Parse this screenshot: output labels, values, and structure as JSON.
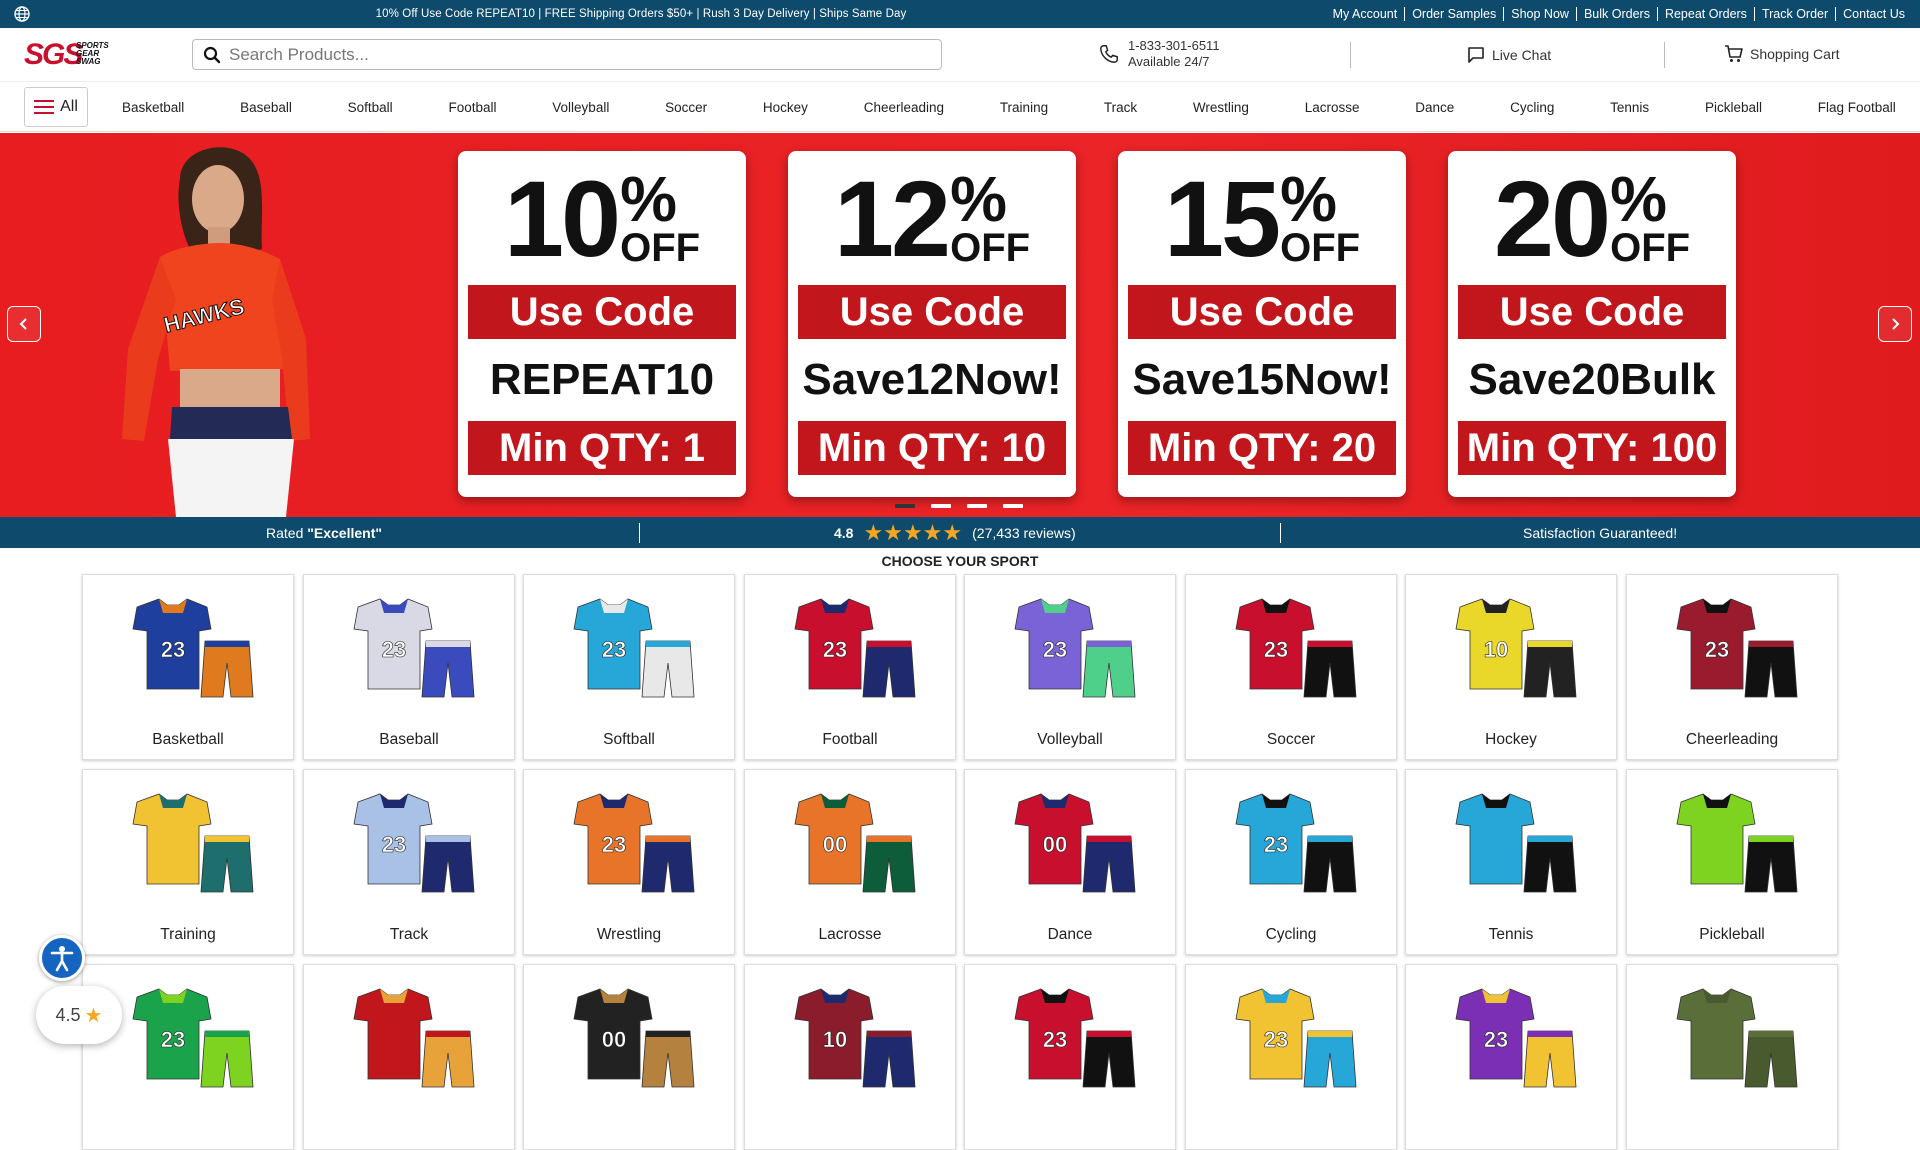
{
  "topbar": {
    "promo": "10% Off Use Code REPEAT10 | FREE Shipping Orders $50+ | Rush 3 Day Delivery | Ships Same Day",
    "links": [
      "My Account",
      "Order Samples",
      "Shop Now",
      "Bulk Orders",
      "Repeat Orders",
      "Track Order",
      "Contact Us"
    ]
  },
  "header": {
    "logo_text": "SGS",
    "logo_sub": [
      "SPORTS",
      "GEAR",
      "SWAG"
    ],
    "search_placeholder": "Search Products...",
    "phone": "1-833-301-6511",
    "phone_hours": "Available 24/7",
    "chat_label": "Live Chat",
    "cart_label": "Shopping Cart"
  },
  "nav": {
    "all_label": "All",
    "items": [
      "Basketball",
      "Baseball",
      "Softball",
      "Football",
      "Volleyball",
      "Soccer",
      "Hockey",
      "Cheerleading",
      "Training",
      "Track",
      "Wrestling",
      "Lacrosse",
      "Dance",
      "Cycling",
      "Tennis",
      "Pickleball",
      "Flag Football"
    ]
  },
  "hero": {
    "model_text": "HAWKS",
    "cards": [
      {
        "num": "10",
        "pct": "%",
        "off": "OFF",
        "use": "Use Code",
        "code": "REPEAT10",
        "min": "Min QTY: 1"
      },
      {
        "num": "12",
        "pct": "%",
        "off": "OFF",
        "use": "Use Code",
        "code": "Save12Now!",
        "min": "Min QTY: 10"
      },
      {
        "num": "15",
        "pct": "%",
        "off": "OFF",
        "use": "Use Code",
        "code": "Save15Now!",
        "min": "Min QTY: 20"
      },
      {
        "num": "20",
        "pct": "%",
        "off": "OFF",
        "use": "Use Code",
        "code": "Save20Bulk",
        "min": "Min QTY: 100"
      }
    ],
    "active_slide": 1,
    "slide_count": 4
  },
  "ratings": {
    "rated_prefix": "Rated ",
    "rated_word": "\"Excellent\"",
    "score": "4.8",
    "reviews": "(27,433 reviews)",
    "guarantee": "Satisfaction Guaranteed!",
    "stars": 5
  },
  "section_title": "CHOOSE YOUR SPORT",
  "sports": [
    {
      "label": "Basketball",
      "c1": "#1f3f9e",
      "c2": "#e07a1e",
      "num": "23"
    },
    {
      "label": "Baseball",
      "c1": "#d9d9e6",
      "c2": "#3a4bbd",
      "num": "23"
    },
    {
      "label": "Softball",
      "c1": "#27a7d8",
      "c2": "#e8e8e8",
      "num": "23"
    },
    {
      "label": "Football",
      "c1": "#c8102e",
      "c2": "#1f2a6e",
      "num": "23"
    },
    {
      "label": "Volleyball",
      "c1": "#7a63d6",
      "c2": "#4fd08a",
      "num": "23"
    },
    {
      "label": "Soccer",
      "c1": "#c8102e",
      "c2": "#111111",
      "num": "23"
    },
    {
      "label": "Hockey",
      "c1": "#e9d82a",
      "c2": "#222222",
      "num": "10"
    },
    {
      "label": "Cheerleading",
      "c1": "#9b1b2e",
      "c2": "#111111",
      "num": "23"
    },
    {
      "label": "Training",
      "c1": "#f1c232",
      "c2": "#1e6e6e",
      "num": ""
    },
    {
      "label": "Track",
      "c1": "#a9c1e6",
      "c2": "#1f2a6e",
      "num": "23"
    },
    {
      "label": "Wrestling",
      "c1": "#e8742a",
      "c2": "#1f2a6e",
      "num": "23"
    },
    {
      "label": "Lacrosse",
      "c1": "#e8742a",
      "c2": "#0d5c3a",
      "num": "00"
    },
    {
      "label": "Dance",
      "c1": "#c8102e",
      "c2": "#1f2a6e",
      "num": "00"
    },
    {
      "label": "Cycling",
      "c1": "#27a7d8",
      "c2": "#111111",
      "num": "23"
    },
    {
      "label": "Tennis",
      "c1": "#27a7d8",
      "c2": "#111111",
      "num": ""
    },
    {
      "label": "Pickleball",
      "c1": "#7ed321",
      "c2": "#111111",
      "num": ""
    },
    {
      "label": "",
      "c1": "#1aa34a",
      "c2": "#7ed321",
      "num": "23"
    },
    {
      "label": "",
      "c1": "#c1161c",
      "c2": "#e8a23a",
      "num": ""
    },
    {
      "label": "",
      "c1": "#222222",
      "c2": "#b5813f",
      "num": "00"
    },
    {
      "label": "",
      "c1": "#8a1c2b",
      "c2": "#1f2a6e",
      "num": "10"
    },
    {
      "label": "",
      "c1": "#c8102e",
      "c2": "#111111",
      "num": "23"
    },
    {
      "label": "",
      "c1": "#f1c232",
      "c2": "#27a7d8",
      "num": "23"
    },
    {
      "label": "",
      "c1": "#7b2fb5",
      "c2": "#f1c232",
      "num": "23"
    },
    {
      "label": "",
      "c1": "#5a6e3a",
      "c2": "#4a5a2f",
      "num": ""
    }
  ],
  "widgets": {
    "rating_value": "4.5"
  },
  "colors": {
    "brand_blue": "#0d4a6b",
    "brand_red": "#e71d20",
    "band_red": "#c1161c",
    "star": "#f5a623"
  }
}
